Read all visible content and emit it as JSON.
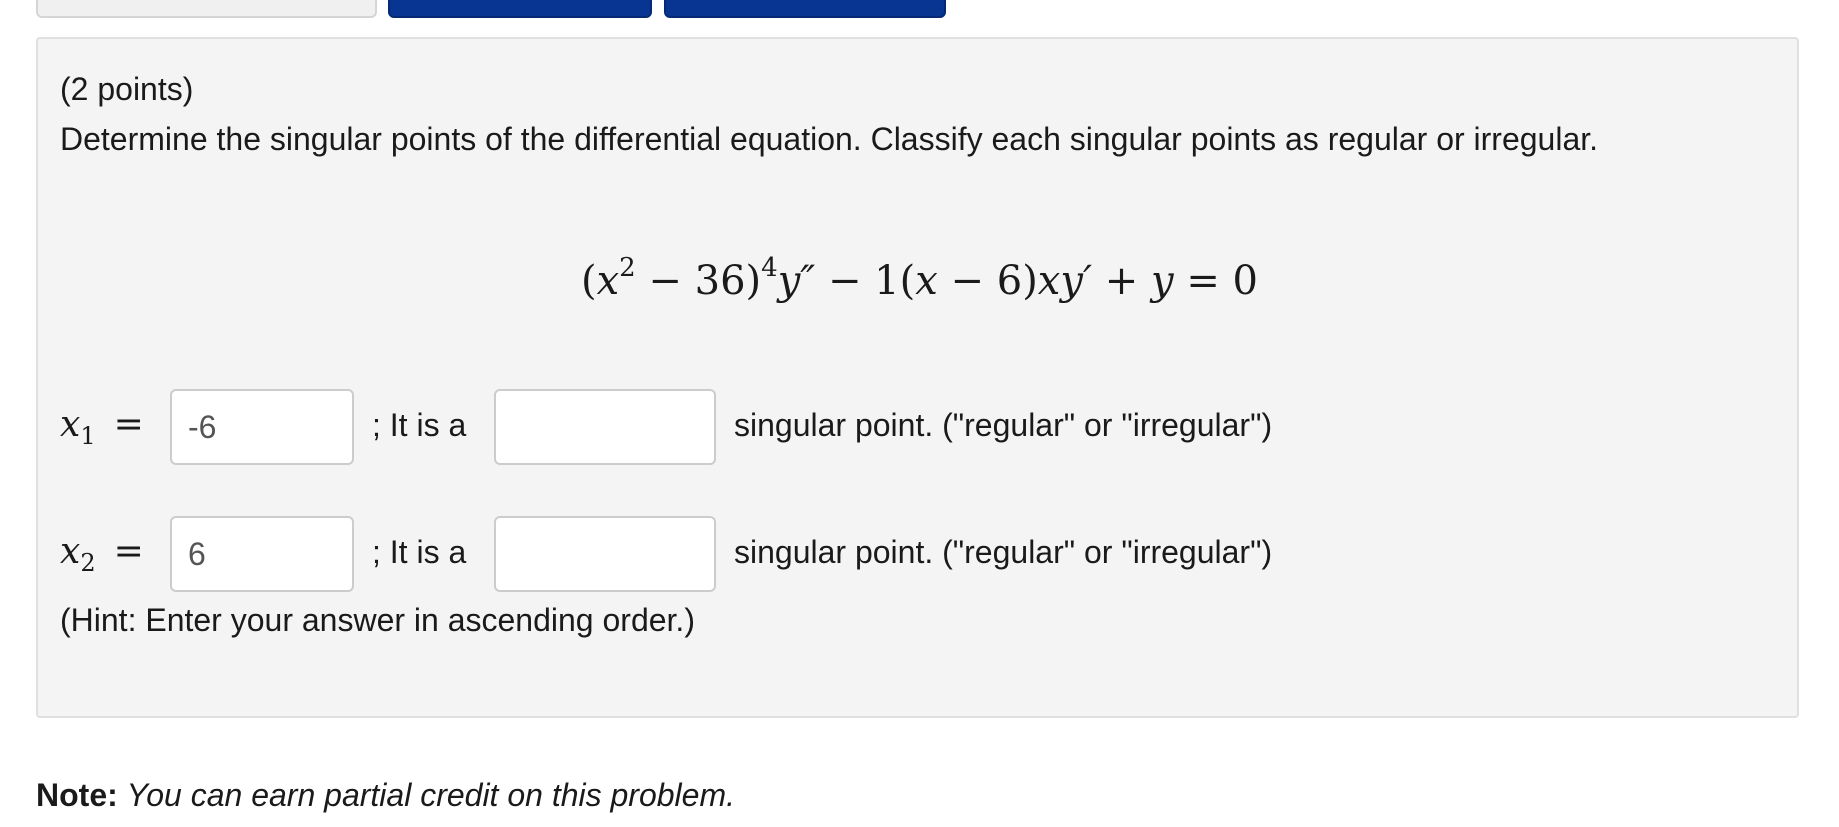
{
  "problem": {
    "points": "(2 points)",
    "instructions": "Determine the singular points of the differential equation. Classify each singular points as regular or irregular.",
    "equation": {
      "open": "(",
      "x1": "x",
      "exp1": "2",
      "minus36": " − 36)",
      "exp4": "4",
      "ypp": "y″",
      "mid": " − 1(",
      "x2": "x",
      "mid2": " − 6)",
      "xyp": "xy′",
      "plus": " + ",
      "y": "y",
      "tail": " = 0"
    },
    "rows": [
      {
        "var": "x",
        "sub": "1",
        "equals": "=",
        "value": "-6",
        "it_is": "; It is a",
        "type_value": "",
        "suffix": "singular point. (\"regular\" or \"irregular\")"
      },
      {
        "var": "x",
        "sub": "2",
        "equals": "=",
        "value": "6",
        "it_is": "; It is a",
        "type_value": "",
        "suffix": "singular point. (\"regular\" or \"irregular\")"
      }
    ],
    "hint": "(Hint: Enter your answer in ascending order.)"
  },
  "note": {
    "label": "Note:",
    "text": "You can earn partial credit on this problem."
  },
  "colors": {
    "button_blue": "#073591",
    "panel_bg": "#f4f4f4"
  }
}
